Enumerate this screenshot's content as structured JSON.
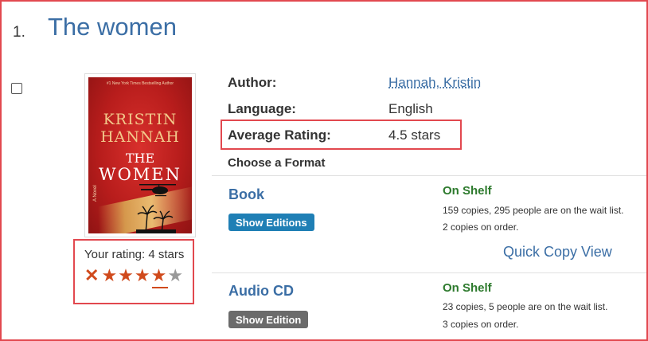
{
  "result": {
    "number": "1.",
    "title": "The women"
  },
  "cover": {
    "tagline": "#1 New York Times Bestselling Author",
    "author_first": "KRISTIN",
    "author_last": "HANNAH",
    "title_the": "THE",
    "title_main": "WOMEN",
    "subtitle": "A Novel"
  },
  "user_rating": {
    "label": "Your rating: 4 stars",
    "value": 4,
    "max": 5
  },
  "details": {
    "author_label": "Author:",
    "author_value": "Hannah, Kristin",
    "language_label": "Language:",
    "language_value": "English",
    "avg_rating_label": "Average Rating:",
    "avg_rating_value": "4.5 stars"
  },
  "choose_format": "Choose a Format",
  "formats": [
    {
      "name": "Book",
      "button": "Show Editions",
      "status": "On Shelf",
      "availability": "159 copies, 295 people are on the wait list.",
      "on_order": "2 copies on order.",
      "quick_copy": "Quick Copy View"
    },
    {
      "name": "Audio CD",
      "button": "Show Edition",
      "status": "On Shelf",
      "availability": "23 copies, 5 people are on the wait list.",
      "on_order": "3 copies on order."
    }
  ],
  "colors": {
    "highlight_border": "#e2484f",
    "link": "#3b6ea5",
    "status_green": "#2d7a2d",
    "star_active": "#d04a1c",
    "star_inactive": "#999999",
    "button_blue": "#1f7fb5",
    "button_gray": "#6b6b6b"
  },
  "icons": {
    "clear_rating": "x-icon",
    "star": "star-icon"
  }
}
